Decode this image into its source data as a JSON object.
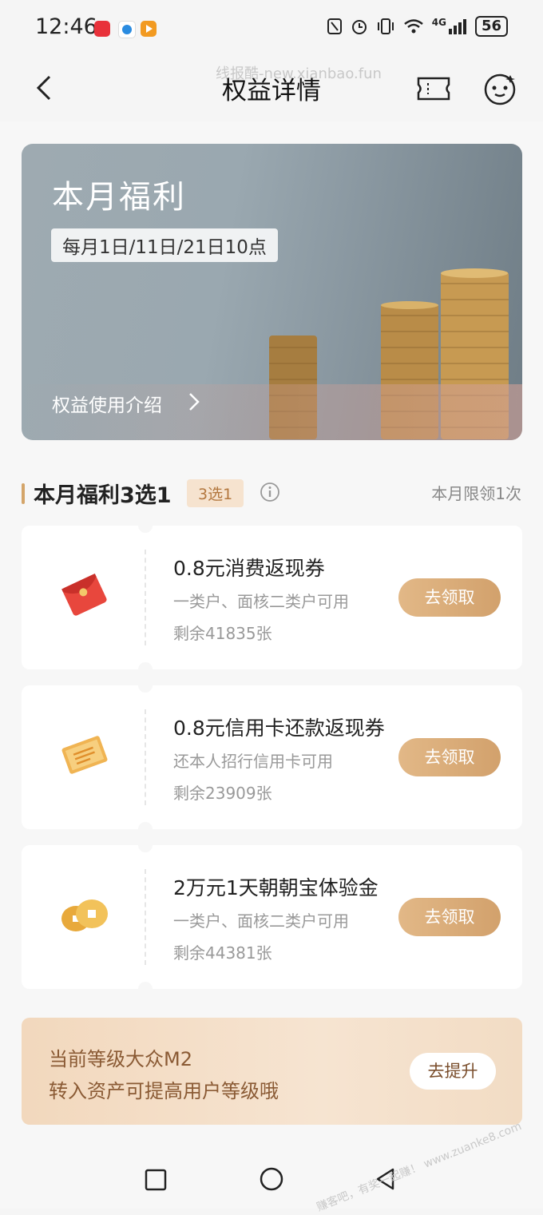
{
  "status_bar": {
    "time": "12:46",
    "network": "4G",
    "battery": "56"
  },
  "nav": {
    "title": "权益详情",
    "watermark": "线报酷-new.xianbao.fun"
  },
  "banner": {
    "title": "本月福利",
    "schedule": "每月1日/11日/21日10点",
    "link": "权益使用介绍"
  },
  "section": {
    "title": "本月福利3选1",
    "badge": "3选1",
    "limit": "本月限领1次"
  },
  "benefits": [
    {
      "title": "0.8元消费返现券",
      "condition": "一类户、面核二类户可用",
      "remaining": "剩余41835张",
      "button": "去领取",
      "icon": "red-envelope-icon"
    },
    {
      "title": "0.8元信用卡还款返现券",
      "condition": "还本人招行信用卡可用",
      "remaining": "剩余23909张",
      "button": "去领取",
      "icon": "coupon-ticket-icon"
    },
    {
      "title": "2万元1天朝朝宝体验金",
      "condition": "一类户、面核二类户可用",
      "remaining": "剩余44381张",
      "button": "去领取",
      "icon": "gold-coin-icon"
    }
  ],
  "level_card": {
    "line1": "当前等级大众M2",
    "line2": "转入资产可提高用户等级哦",
    "button": "去提升"
  },
  "corner_watermark": "赚客吧，有奖一起赚！ www.zuanke8.com"
}
